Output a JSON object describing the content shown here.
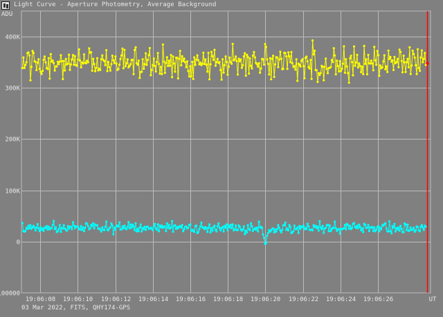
{
  "window": {
    "title": "Light Curve - Aperture Photometry, Average Background",
    "icon": "light-curve-app-icon"
  },
  "footer": {
    "info": "03 Mar 2022, FITS, QHY174-GPS"
  },
  "colors": {
    "background": "#808080",
    "grid": "#bdbdbd",
    "series_target": "#ffff00",
    "series_background": "#00ffff",
    "cursor": "#ff0000",
    "text": "#e8e8e8"
  },
  "chart_data": {
    "type": "line",
    "ylabel": "ADU",
    "xlabel": "UT",
    "x_unit": "seconds after 19:06:07",
    "xlim": [
      0,
      21.8
    ],
    "ylim": [
      -100000,
      450000
    ],
    "y_ticks": [
      {
        "value": 400000,
        "label": "400K"
      },
      {
        "value": 300000,
        "label": "300K"
      },
      {
        "value": 200000,
        "label": "200K"
      },
      {
        "value": 100000,
        "label": "100K"
      },
      {
        "value": 0,
        "label": "0"
      },
      {
        "value": -100000,
        "label": "100000"
      }
    ],
    "x_ticks": [
      {
        "value": 1,
        "label": "19:06:08"
      },
      {
        "value": 3,
        "label": "19:06:10"
      },
      {
        "value": 5,
        "label": "19:06:12"
      },
      {
        "value": 7,
        "label": "19:06:14"
      },
      {
        "value": 9,
        "label": "19:06:16"
      },
      {
        "value": 11,
        "label": "19:06:18"
      },
      {
        "value": 13,
        "label": "19:06:20"
      },
      {
        "value": 15,
        "label": "19:06:22"
      },
      {
        "value": 17,
        "label": "19:06:24"
      },
      {
        "value": 19,
        "label": "19:06:26"
      }
    ],
    "grid": true,
    "cursor_x": 21.6,
    "series": [
      {
        "key": "target",
        "style": "yellow-line-with-dots",
        "approx_mean": 348000,
        "approx_range": [
          262000,
          438000
        ],
        "samples": 400
      },
      {
        "key": "background",
        "style": "cyan-line-with-dots",
        "approx_mean": 27000,
        "approx_range": [
          -10000,
          47000
        ],
        "samples": 400,
        "dip_at_x": 13.0
      }
    ]
  }
}
